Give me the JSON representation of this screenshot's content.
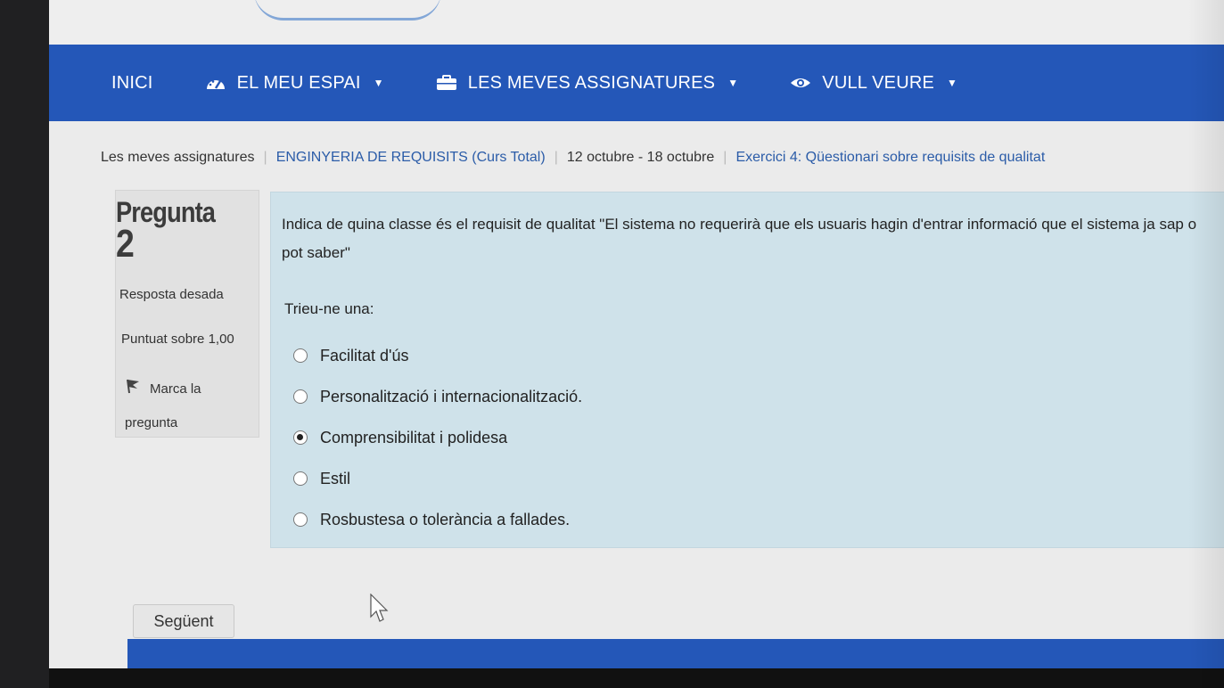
{
  "nav": {
    "items": [
      {
        "label": "INICI",
        "icon": "none",
        "dropdown": false
      },
      {
        "label": "EL MEU ESPAI",
        "icon": "dashboard-icon",
        "dropdown": true
      },
      {
        "label": "LES MEVES ASSIGNATURES",
        "icon": "briefcase-icon",
        "dropdown": true
      },
      {
        "label": "VULL VEURE",
        "icon": "eye-icon",
        "dropdown": true
      }
    ],
    "caret": "▼"
  },
  "breadcrumb": {
    "items": [
      "Les meves assignatures",
      "ENGINYERIA DE REQUISITS (Curs Total)",
      "12 octubre - 18 octubre",
      "Exercici 4: Qüestionari sobre requisits de qualitat"
    ],
    "separator": "|"
  },
  "question_info": {
    "title": "Pregunta",
    "number": "2",
    "status": "Resposta desada",
    "grade": "Puntuat sobre 1,00",
    "flag_label": "Marca la pregunta"
  },
  "question": {
    "text": "Indica de quina classe és el requisit de qualitat \"El sistema no requerirà que els usuaris hagin d'entrar informació que el sistema ja sap o pot saber\"",
    "prompt": "Trieu-ne una:",
    "options": [
      {
        "label": "Facilitat d'ús",
        "selected": false
      },
      {
        "label": "Personalització i internacionalització.",
        "selected": false
      },
      {
        "label": "Comprensibilitat i polidesa",
        "selected": true
      },
      {
        "label": "Estil",
        "selected": false
      },
      {
        "label": "Rosbustesa o tolerància a fallades.",
        "selected": false
      }
    ]
  },
  "actions": {
    "next_label": "Següent"
  },
  "colors": {
    "navbar": "#2457b8",
    "panel": "#cfe2ea",
    "link": "#2b5ca8"
  }
}
